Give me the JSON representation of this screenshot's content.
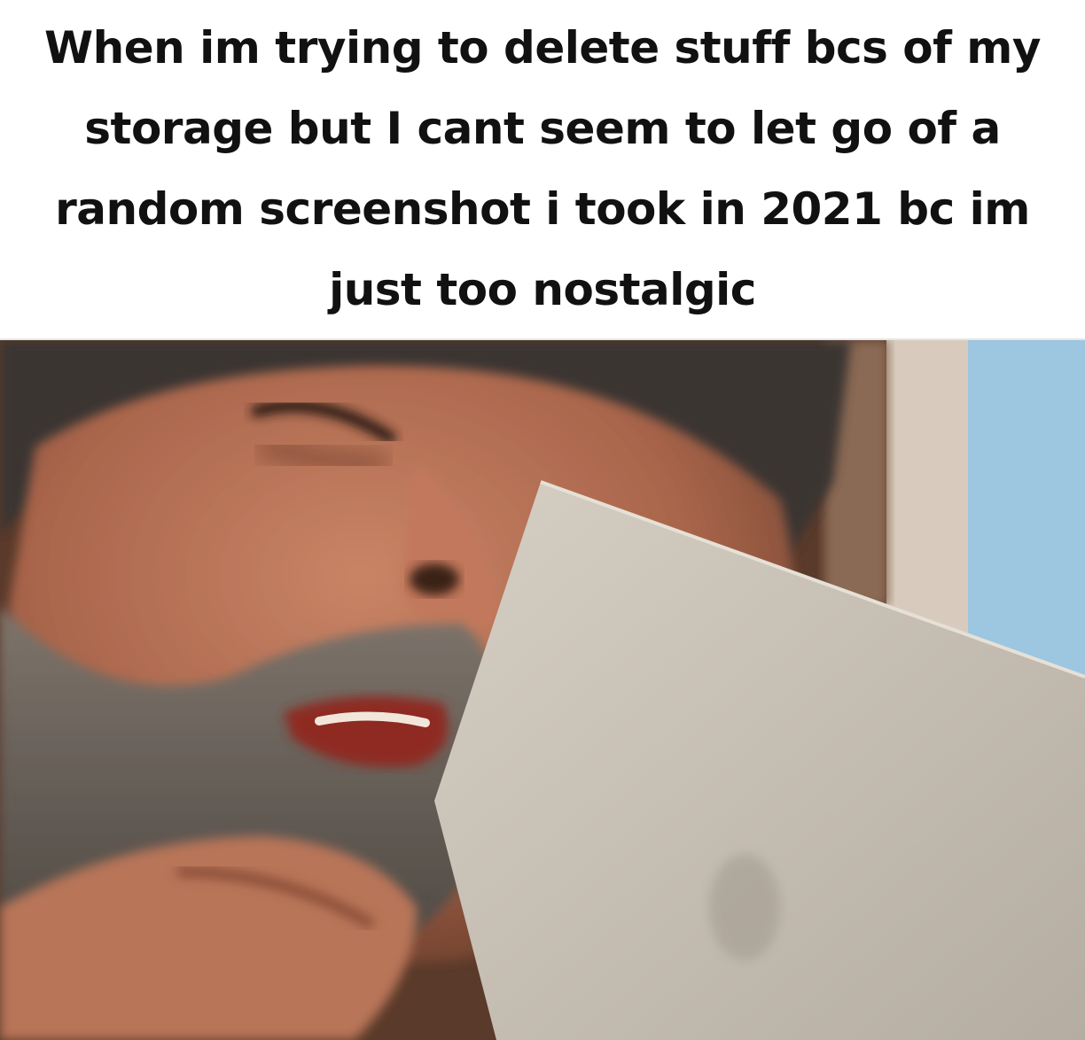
{
  "caption": {
    "text": "When im trying to delete stuff bcs of my storage but I cant seem to let go of a random screenshot i took in 2021 bc im just too nostalgic"
  },
  "photo": {
    "subject": "bearded-man-tearfully-reading-paper",
    "colors": {
      "skin": "#b8735a",
      "skin_shadow": "#6b3f2c",
      "beard": "#6f6a64",
      "hair": "#3b3430",
      "paper": "#c9c2b6",
      "wall": "#d8cbbd",
      "sky": "#9dc6e0"
    }
  }
}
